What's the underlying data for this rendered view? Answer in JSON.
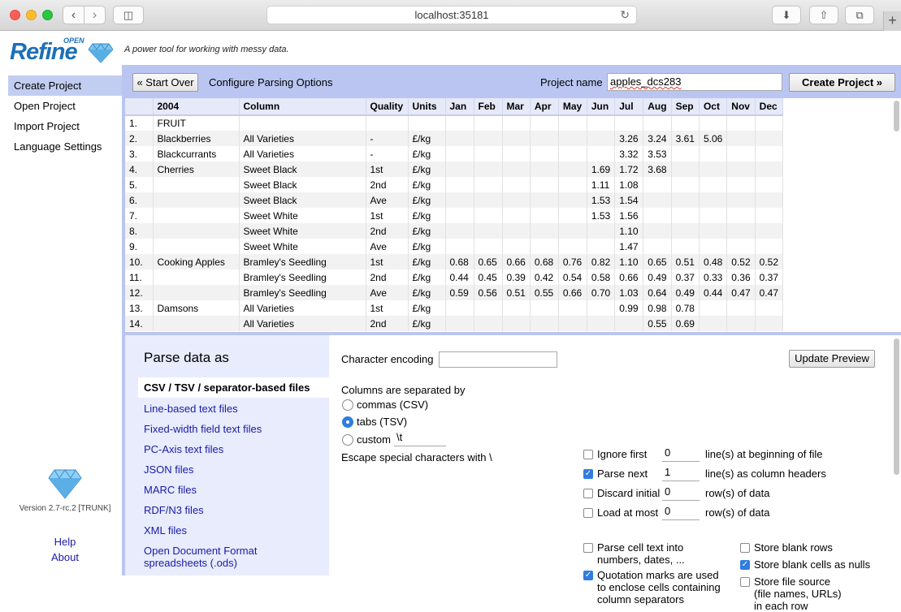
{
  "browser": {
    "url": "localhost:35181"
  },
  "app": {
    "logo_text": "Refine",
    "logo_open": "OPEN",
    "tagline": "A power tool for working with messy data.",
    "version": "Version 2.7-rc.2 [TRUNK]"
  },
  "nav": {
    "items": [
      "Create Project",
      "Open Project",
      "Import Project",
      "Language Settings"
    ],
    "help": "Help",
    "about": "About"
  },
  "toolbar": {
    "start_over": "« Start Over",
    "configure_label": "Configure Parsing Options",
    "project_name_label": "Project name",
    "project_name_value": "apples_dcs283",
    "create_project": "Create Project »"
  },
  "preview": {
    "headers": [
      "",
      "2004",
      "Column",
      "Quality",
      "Units",
      "Jan",
      "Feb",
      "Mar",
      "Apr",
      "May",
      "Jun",
      "Jul",
      "Aug",
      "Sep",
      "Oct",
      "Nov",
      "Dec"
    ],
    "rows": [
      [
        "1.",
        "FRUIT",
        "",
        "",
        "",
        "",
        "",
        "",
        "",
        "",
        "",
        "",
        "",
        "",
        "",
        "",
        ""
      ],
      [
        "2.",
        "Blackberries",
        "All Varieties",
        "-",
        "£/kg",
        "",
        "",
        "",
        "",
        "",
        "",
        "3.26",
        "3.24",
        "3.61",
        "5.06",
        "",
        ""
      ],
      [
        "3.",
        "Blackcurrants",
        "All Varieties",
        "-",
        "£/kg",
        "",
        "",
        "",
        "",
        "",
        "",
        "3.32",
        "3.53",
        "",
        "",
        "",
        ""
      ],
      [
        "4.",
        "Cherries",
        "Sweet Black",
        "1st",
        "£/kg",
        "",
        "",
        "",
        "",
        "",
        "1.69",
        "1.72",
        "3.68",
        "",
        "",
        "",
        ""
      ],
      [
        "5.",
        "",
        "Sweet Black",
        "2nd",
        "£/kg",
        "",
        "",
        "",
        "",
        "",
        "1.11",
        "1.08",
        "",
        "",
        "",
        "",
        ""
      ],
      [
        "6.",
        "",
        "Sweet Black",
        "Ave",
        "£/kg",
        "",
        "",
        "",
        "",
        "",
        "1.53",
        "1.54",
        "",
        "",
        "",
        "",
        ""
      ],
      [
        "7.",
        "",
        "Sweet White",
        "1st",
        "£/kg",
        "",
        "",
        "",
        "",
        "",
        "1.53",
        "1.56",
        "",
        "",
        "",
        "",
        ""
      ],
      [
        "8.",
        "",
        "Sweet White",
        "2nd",
        "£/kg",
        "",
        "",
        "",
        "",
        "",
        "",
        "1.10",
        "",
        "",
        "",
        "",
        ""
      ],
      [
        "9.",
        "",
        "Sweet White",
        "Ave",
        "£/kg",
        "",
        "",
        "",
        "",
        "",
        "",
        "1.47",
        "",
        "",
        "",
        "",
        ""
      ],
      [
        "10.",
        "Cooking Apples",
        "Bramley's Seedling",
        "1st",
        "£/kg",
        "0.68",
        "0.65",
        "0.66",
        "0.68",
        "0.76",
        "0.82",
        "1.10",
        "0.65",
        "0.51",
        "0.48",
        "0.52",
        "0.52"
      ],
      [
        "11.",
        "",
        "Bramley's Seedling",
        "2nd",
        "£/kg",
        "0.44",
        "0.45",
        "0.39",
        "0.42",
        "0.54",
        "0.58",
        "0.66",
        "0.49",
        "0.37",
        "0.33",
        "0.36",
        "0.37"
      ],
      [
        "12.",
        "",
        "Bramley's Seedling",
        "Ave",
        "£/kg",
        "0.59",
        "0.56",
        "0.51",
        "0.55",
        "0.66",
        "0.70",
        "1.03",
        "0.64",
        "0.49",
        "0.44",
        "0.47",
        "0.47"
      ],
      [
        "13.",
        "Damsons",
        "All Varieties",
        "1st",
        "£/kg",
        "",
        "",
        "",
        "",
        "",
        "",
        "0.99",
        "0.98",
        "0.78",
        "",
        "",
        ""
      ],
      [
        "14.",
        "",
        "All Varieties",
        "2nd",
        "£/kg",
        "",
        "",
        "",
        "",
        "",
        "",
        "",
        "0.55",
        "0.69",
        "",
        "",
        ""
      ]
    ]
  },
  "parse": {
    "title": "Parse data as",
    "formats": [
      "CSV / TSV / separator-based files",
      "Line-based text files",
      "Fixed-width field text files",
      "PC-Axis text files",
      "JSON files",
      "MARC files",
      "RDF/N3 files",
      "XML files",
      "Open Document Format spreadsheets (.ods)"
    ],
    "selected_format": "CSV / TSV / separator-based files"
  },
  "options": {
    "character_encoding_label": "Character encoding",
    "character_encoding_value": "",
    "update_preview": "Update Preview",
    "separated_by_label": "Columns are separated by",
    "sep_commas": "commas (CSV)",
    "sep_tabs": "tabs (TSV)",
    "sep_custom": "custom",
    "sep_custom_value": "\\t",
    "selected_separator": "tabs (TSV)",
    "escape_label": "Escape special characters with \\",
    "ignore_first_label": "Ignore first",
    "ignore_first_value": "0",
    "ignore_first_suffix": "line(s) at beginning of file",
    "ignore_first_checked": false,
    "parse_next_label": "Parse next",
    "parse_next_value": "1",
    "parse_next_suffix": "line(s) as column headers",
    "parse_next_checked": true,
    "discard_initial_label": "Discard initial",
    "discard_initial_value": "0",
    "discard_initial_suffix": "row(s) of data",
    "discard_initial_checked": false,
    "load_at_most_label": "Load at most",
    "load_at_most_value": "0",
    "load_at_most_suffix": "row(s) of data",
    "load_at_most_checked": false,
    "parse_cell_text_1": "Parse cell text into",
    "parse_cell_text_2": "numbers, dates, ...",
    "parse_cell_text_checked": false,
    "quotation_1": "Quotation marks are used",
    "quotation_2": "to enclose cells containing",
    "quotation_3": "column separators",
    "quotation_checked": true,
    "store_blank_rows": "Store blank rows",
    "store_blank_rows_checked": false,
    "store_blank_cells": "Store blank cells as nulls",
    "store_blank_cells_checked": true,
    "store_file_source_1": "Store file source",
    "store_file_source_2": "(file names, URLs)",
    "store_file_source_3": "in each row",
    "store_file_source_checked": false
  }
}
